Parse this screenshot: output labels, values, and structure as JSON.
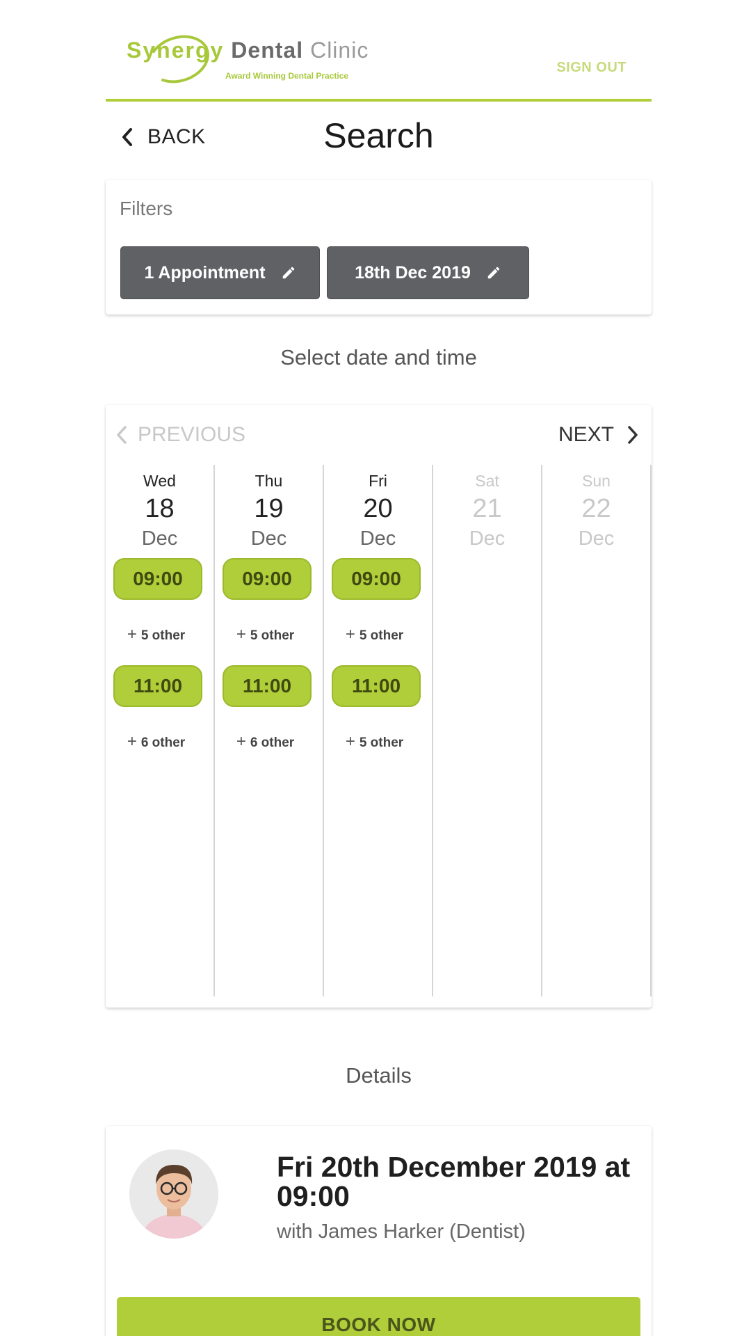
{
  "header": {
    "logo": {
      "word1": "Synergy",
      "word2": "Dental",
      "word3": "Clinic",
      "tagline": "Award Winning Dental Practice"
    },
    "sign_out": "SIGN OUT"
  },
  "title_bar": {
    "back_label": "BACK",
    "title": "Search"
  },
  "filters": {
    "label": "Filters",
    "chips": [
      "1 Appointment",
      "18th Dec 2019"
    ]
  },
  "select_title": "Select date and time",
  "calendar": {
    "prev_label": "PREVIOUS",
    "next_label": "NEXT",
    "days": [
      {
        "name": "Wed",
        "num": "18",
        "month": "Dec",
        "slots": [
          "09:00",
          "11:00"
        ],
        "others": [
          "5 other",
          "6 other"
        ]
      },
      {
        "name": "Thu",
        "num": "19",
        "month": "Dec",
        "slots": [
          "09:00",
          "11:00"
        ],
        "others": [
          "5 other",
          "6 other"
        ]
      },
      {
        "name": "Fri",
        "num": "20",
        "month": "Dec",
        "slots": [
          "09:00",
          "11:00"
        ],
        "others": [
          "5 other",
          "5 other"
        ]
      },
      {
        "name": "Sat",
        "num": "21",
        "month": "Dec"
      },
      {
        "name": "Sun",
        "num": "22",
        "month": "Dec"
      }
    ]
  },
  "details": {
    "section_title": "Details",
    "title": "Fri 20th December 2019 at 09:00",
    "subtitle": "with James Harker (Dentist)",
    "book_label": "BOOK NOW"
  },
  "colors": {
    "accent": "#b0cd3a",
    "chip": "#5f6164",
    "disabled": "#c8c8c8"
  }
}
